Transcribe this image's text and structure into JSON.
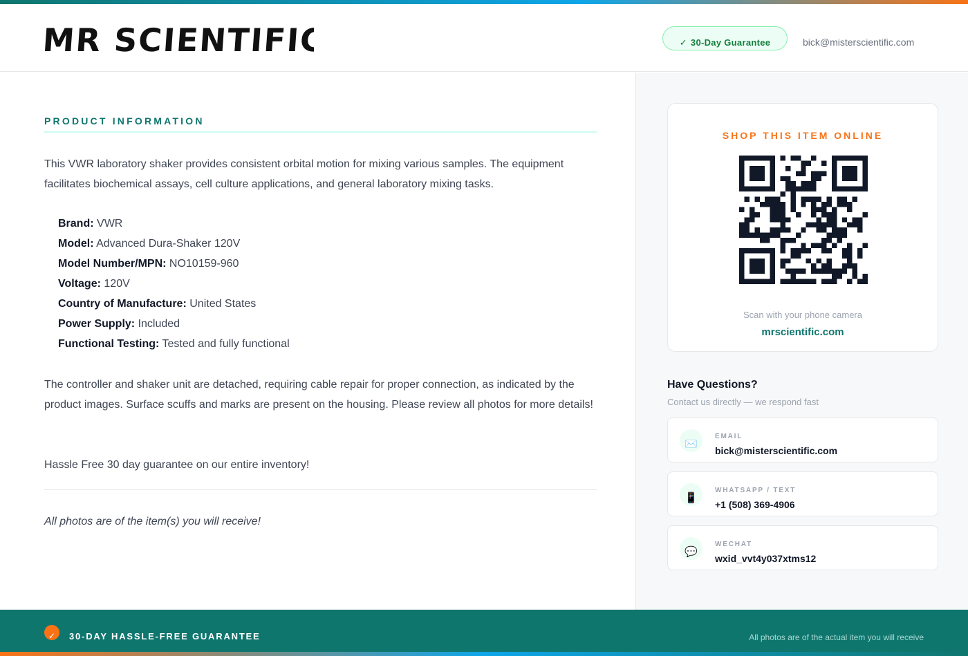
{
  "header": {
    "logo_text": "MR SCIENTIFIC",
    "guarantee_badge": "30-Day Guarantee",
    "guarantee_check": "✓",
    "email": "bick@misterscientific.com"
  },
  "product": {
    "heading": "PRODUCT INFORMATION",
    "intro": "This VWR laboratory shaker provides consistent orbital motion for mixing various samples. The equipment facilitates biochemical assays, cell culture applications, and general laboratory mixing tasks.",
    "specs": [
      {
        "label": "Brand:",
        "value": "VWR"
      },
      {
        "label": "Model:",
        "value": "Advanced Dura-Shaker 120V"
      },
      {
        "label": "Model Number/MPN:",
        "value": "NO10159-960"
      },
      {
        "label": "Voltage:",
        "value": "120V"
      },
      {
        "label": "Country of Manufacture:",
        "value": "United States"
      },
      {
        "label": "Power Supply:",
        "value": "Included"
      },
      {
        "label": "Functional Testing:",
        "value": "Tested and fully functional"
      }
    ],
    "condition": "The controller and shaker unit are detached, requiring cable repair for proper connection, as indicated by the product images. Surface scuffs and marks are present on the housing. Please review all photos for more details!",
    "guarantee_text": "Hassle Free 30 day guarantee on our entire inventory!",
    "photos_note": "All photos are of the item(s) you will receive!"
  },
  "shop": {
    "title": "SHOP THIS ITEM ONLINE",
    "caption": "Scan with your phone camera",
    "link": "mrscientific.com"
  },
  "contact": {
    "title": "Have Questions?",
    "subtitle": "Contact us directly — we respond fast",
    "cards": [
      {
        "icon": "envelope-icon",
        "glyph": "✉️",
        "label": "EMAIL",
        "value": "bick@misterscientific.com"
      },
      {
        "icon": "phone-icon",
        "glyph": "📱",
        "label": "WHATSAPP / TEXT",
        "value": "+1 (508) 369-4906"
      },
      {
        "icon": "chat-icon",
        "glyph": "💬",
        "label": "WECHAT",
        "value": "wxid_vvt4y037xtms12"
      }
    ]
  },
  "footer": {
    "check": "✓",
    "guarantee": "30-DAY HASSLE-FREE GUARANTEE",
    "note": "All photos are of the actual item you will receive"
  },
  "colors": {
    "teal": "#0f766e",
    "orange": "#f97316",
    "green": "#15803d",
    "dark": "#111827"
  }
}
